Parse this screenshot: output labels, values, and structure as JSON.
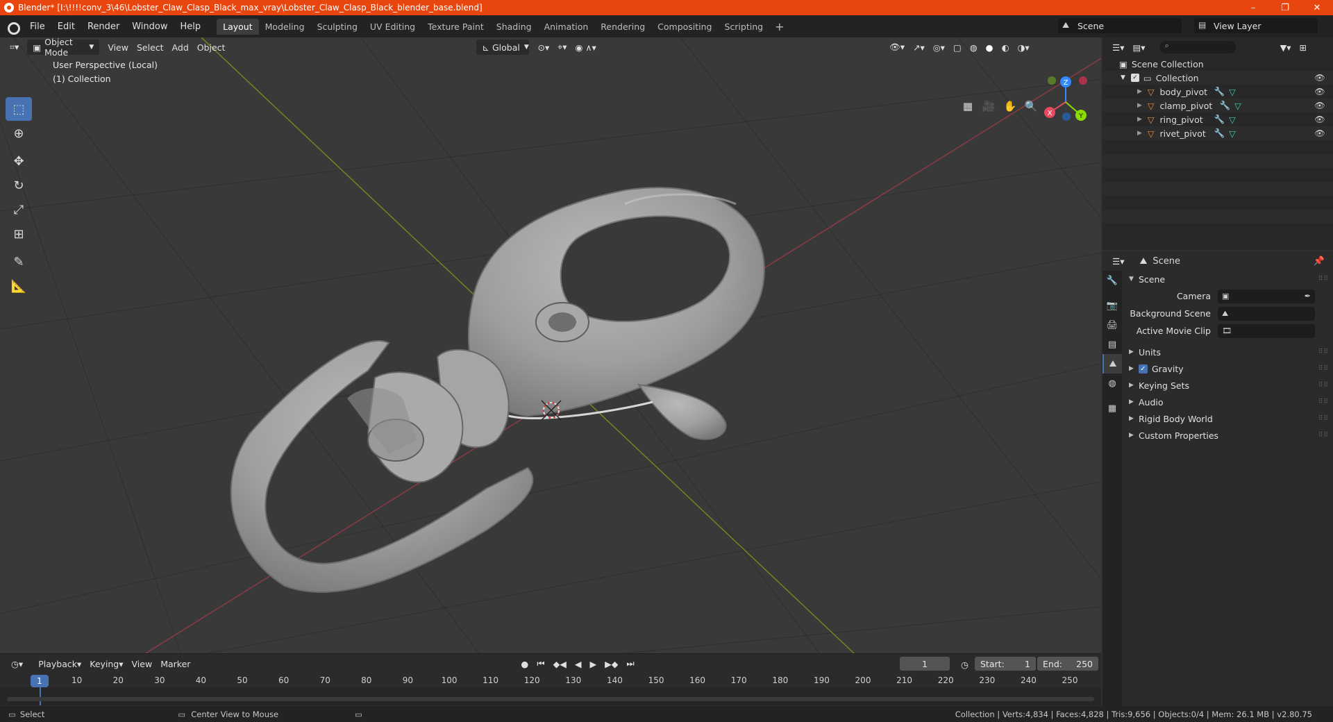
{
  "window": {
    "title": "Blender* [I:\\!!!!conv_3\\46\\Lobster_Claw_Clasp_Black_max_vray\\Lobster_Claw_Clasp_Black_blender_base.blend]",
    "minimize": "–",
    "maximize": "❐",
    "close": "✕"
  },
  "menu": [
    "File",
    "Edit",
    "Render",
    "Window",
    "Help"
  ],
  "workspaces": [
    "Layout",
    "Modeling",
    "Sculpting",
    "UV Editing",
    "Texture Paint",
    "Shading",
    "Animation",
    "Rendering",
    "Compositing",
    "Scripting"
  ],
  "workspace_add": "+",
  "scene_selector": "Scene",
  "view_layer_selector": "View Layer",
  "viewport": {
    "mode": "Object Mode",
    "menus": [
      "View",
      "Select",
      "Add",
      "Object"
    ],
    "transform_orientation": "Global",
    "info_line1": "User Perspective (Local)",
    "info_line2": "(1) Collection"
  },
  "gizmo": {
    "x": "X",
    "y": "Y",
    "z": "Z"
  },
  "timeline": {
    "menus": [
      "Playback",
      "Keying",
      "View",
      "Marker"
    ],
    "current_frame": "1",
    "start_label": "Start:",
    "start": "1",
    "end_label": "End:",
    "end": "250",
    "ruler": [
      "1",
      "10",
      "20",
      "30",
      "40",
      "50",
      "60",
      "70",
      "80",
      "90",
      "100",
      "110",
      "120",
      "130",
      "140",
      "150",
      "160",
      "170",
      "180",
      "190",
      "200",
      "210",
      "220",
      "230",
      "240",
      "250"
    ]
  },
  "statusbar": {
    "left_action": "Select",
    "mid_action": "Center View to Mouse",
    "stats": "Collection | Verts:4,834 | Faces:4,828 | Tris:9,656 | Objects:0/4 | Mem: 26.1 MB | v2.80.75"
  },
  "outliner": {
    "root": "Scene Collection",
    "collection": "Collection",
    "objects": [
      "body_pivot",
      "clamp_pivot",
      "ring_pivot",
      "rivet_pivot"
    ]
  },
  "properties": {
    "header": "Scene",
    "panel_title": "Scene",
    "camera_label": "Camera",
    "background_scene_label": "Background Scene",
    "active_clip_label": "Active Movie Clip",
    "sections": [
      "Units",
      "Gravity",
      "Keying Sets",
      "Audio",
      "Rigid Body World",
      "Custom Properties"
    ]
  },
  "colors": {
    "accent": "#4772b3",
    "title_bar": "#e8460e",
    "x_axis": "#e84a5f",
    "y_axis": "#8bdc00",
    "z_axis": "#2f8bff"
  }
}
